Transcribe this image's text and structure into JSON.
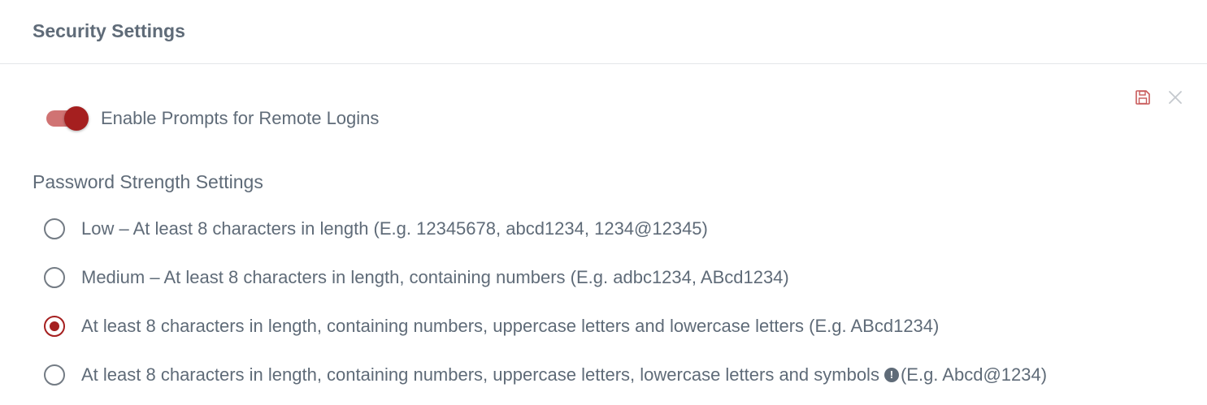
{
  "header": {
    "title": "Security Settings"
  },
  "toolbar": {
    "save_icon": "save-icon",
    "close_icon": "close-icon"
  },
  "remote_login": {
    "label": "Enable Prompts for Remote Logins",
    "enabled": true
  },
  "password_strength": {
    "title": "Password Strength Settings",
    "options": [
      {
        "label": "Low – At least 8 characters in length (E.g. 12345678, abcd1234, 1234@12345)",
        "selected": false
      },
      {
        "label": "Medium – At least 8 characters in length, containing numbers (E.g. adbc1234, ABcd1234)",
        "selected": false
      },
      {
        "label": "At least 8 characters in length, containing numbers, uppercase letters and lowercase letters (E.g. ABcd1234)",
        "selected": true
      },
      {
        "label": "At least 8 characters in length, containing numbers, uppercase letters, lowercase letters and symbols",
        "suffix": "(E.g. Abcd@1234)",
        "selected": false
      }
    ]
  },
  "colors": {
    "accent": "#a51f1f",
    "accent_light": "#d07373",
    "text": "#5f6b78",
    "divider": "#e3e6e9"
  }
}
